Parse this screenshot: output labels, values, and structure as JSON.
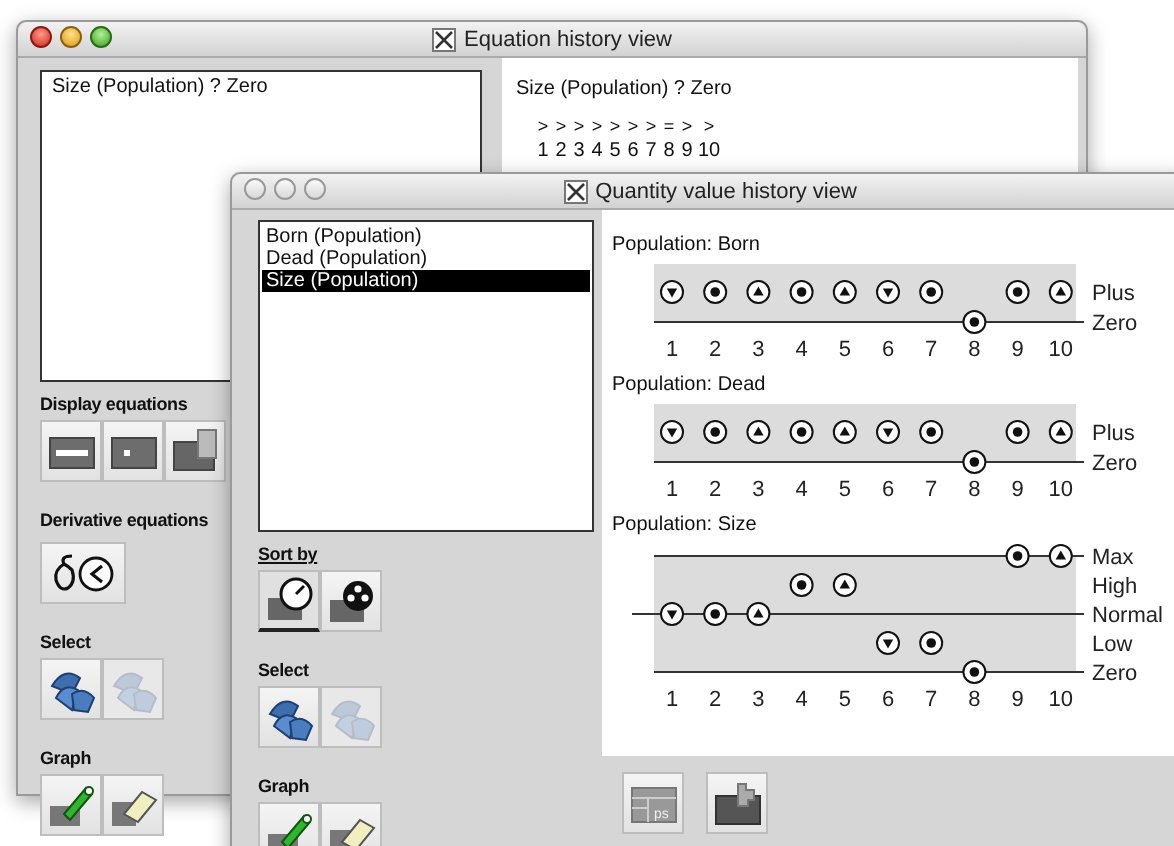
{
  "equation_window": {
    "title": "Equation history view",
    "active": true,
    "list": [
      "Size (Population) ? Zero"
    ],
    "equation": {
      "text": "Size (Population) ? Zero",
      "columns": [
        {
          "symbol": ">",
          "index": "1"
        },
        {
          "symbol": ">",
          "index": "2"
        },
        {
          "symbol": ">",
          "index": "3"
        },
        {
          "symbol": ">",
          "index": "4"
        },
        {
          "symbol": ">",
          "index": "5"
        },
        {
          "symbol": ">",
          "index": "6"
        },
        {
          "symbol": ">",
          "index": "7"
        },
        {
          "symbol": "=",
          "index": "8"
        },
        {
          "symbol": ">",
          "index": "9"
        },
        {
          "symbol": ">",
          "index": "10"
        }
      ]
    },
    "sections": [
      {
        "heading": "Display equations",
        "buttons": [
          {
            "kind": "wide",
            "disabled": false
          },
          {
            "kind": "small",
            "disabled": false
          },
          {
            "kind": "folder-doc",
            "disabled": false
          }
        ]
      },
      {
        "heading": "Derivative equations",
        "buttons": [
          {
            "kind": "delta",
            "disabled": false
          }
        ]
      },
      {
        "heading": "Select",
        "buttons": [
          {
            "kind": "shapes",
            "disabled": false
          },
          {
            "kind": "shapes",
            "disabled": true
          }
        ]
      },
      {
        "heading": "Graph",
        "buttons": [
          {
            "kind": "pencil",
            "disabled": false
          },
          {
            "kind": "eraser",
            "disabled": false
          }
        ]
      }
    ]
  },
  "quantity_window": {
    "title": "Quantity value history view",
    "active": false,
    "list": [
      {
        "label": "Born (Population)",
        "selected": false
      },
      {
        "label": "Dead (Population)",
        "selected": false
      },
      {
        "label": "Size (Population)",
        "selected": true
      }
    ],
    "sort_by": {
      "heading": "Sort by",
      "buttons": [
        {
          "kind": "gauge",
          "selected": true
        },
        {
          "kind": "film",
          "selected": false
        }
      ]
    },
    "sections": [
      {
        "heading": "Select",
        "buttons": [
          {
            "kind": "shapes",
            "disabled": false
          },
          {
            "kind": "shapes",
            "disabled": true
          }
        ]
      },
      {
        "heading": "Graph",
        "buttons": [
          {
            "kind": "pencil",
            "disabled": false
          },
          {
            "kind": "eraser",
            "disabled": false
          }
        ]
      }
    ],
    "graphs": [
      {
        "title": "Population: Born",
        "steps": [
          "1",
          "2",
          "3",
          "4",
          "5",
          "6",
          "7",
          "8",
          "9",
          "10"
        ],
        "rows": [
          {
            "label": "Plus",
            "kind": "interval",
            "marks": [
              {
                "kind": "down"
              },
              {
                "kind": "steady"
              },
              {
                "kind": "up"
              },
              {
                "kind": "steady"
              },
              {
                "kind": "up"
              },
              {
                "kind": "down"
              },
              {
                "kind": "steady"
              },
              {
                "kind": "none"
              },
              {
                "kind": "steady"
              },
              {
                "kind": "up"
              }
            ]
          },
          {
            "label": "Zero",
            "kind": "point",
            "marks": [
              {
                "kind": "none"
              },
              {
                "kind": "none"
              },
              {
                "kind": "none"
              },
              {
                "kind": "none"
              },
              {
                "kind": "none"
              },
              {
                "kind": "none"
              },
              {
                "kind": "none"
              },
              {
                "kind": "steady"
              },
              {
                "kind": "none"
              },
              {
                "kind": "none"
              }
            ]
          }
        ]
      },
      {
        "title": "Population: Dead",
        "steps": [
          "1",
          "2",
          "3",
          "4",
          "5",
          "6",
          "7",
          "8",
          "9",
          "10"
        ],
        "rows": [
          {
            "label": "Plus",
            "kind": "interval",
            "marks": [
              {
                "kind": "down"
              },
              {
                "kind": "steady"
              },
              {
                "kind": "up"
              },
              {
                "kind": "steady"
              },
              {
                "kind": "up"
              },
              {
                "kind": "down"
              },
              {
                "kind": "steady"
              },
              {
                "kind": "none"
              },
              {
                "kind": "steady"
              },
              {
                "kind": "up"
              }
            ]
          },
          {
            "label": "Zero",
            "kind": "point",
            "marks": [
              {
                "kind": "none"
              },
              {
                "kind": "none"
              },
              {
                "kind": "none"
              },
              {
                "kind": "none"
              },
              {
                "kind": "none"
              },
              {
                "kind": "none"
              },
              {
                "kind": "none"
              },
              {
                "kind": "steady"
              },
              {
                "kind": "none"
              },
              {
                "kind": "none"
              }
            ]
          }
        ]
      },
      {
        "title": "Population: Size",
        "steps": [
          "1",
          "2",
          "3",
          "4",
          "5",
          "6",
          "7",
          "8",
          "9",
          "10"
        ],
        "rows": [
          {
            "label": "Max",
            "kind": "point",
            "marks": [
              {
                "kind": "none"
              },
              {
                "kind": "none"
              },
              {
                "kind": "none"
              },
              {
                "kind": "none"
              },
              {
                "kind": "none"
              },
              {
                "kind": "none"
              },
              {
                "kind": "none"
              },
              {
                "kind": "none"
              },
              {
                "kind": "steady"
              },
              {
                "kind": "up"
              }
            ]
          },
          {
            "label": "High",
            "kind": "interval",
            "marks": [
              {
                "kind": "none"
              },
              {
                "kind": "none"
              },
              {
                "kind": "none"
              },
              {
                "kind": "steady"
              },
              {
                "kind": "up"
              },
              {
                "kind": "none"
              },
              {
                "kind": "none"
              },
              {
                "kind": "none"
              },
              {
                "kind": "none"
              },
              {
                "kind": "none"
              }
            ]
          },
          {
            "label": "Normal",
            "kind": "point",
            "marks": [
              {
                "kind": "down"
              },
              {
                "kind": "steady"
              },
              {
                "kind": "up"
              },
              {
                "kind": "none"
              },
              {
                "kind": "none"
              },
              {
                "kind": "none"
              },
              {
                "kind": "none"
              },
              {
                "kind": "none"
              },
              {
                "kind": "none"
              },
              {
                "kind": "none"
              }
            ]
          },
          {
            "label": "Low",
            "kind": "interval",
            "marks": [
              {
                "kind": "none"
              },
              {
                "kind": "none"
              },
              {
                "kind": "none"
              },
              {
                "kind": "none"
              },
              {
                "kind": "none"
              },
              {
                "kind": "down"
              },
              {
                "kind": "steady"
              },
              {
                "kind": "none"
              },
              {
                "kind": "none"
              },
              {
                "kind": "none"
              }
            ]
          },
          {
            "label": "Zero",
            "kind": "point",
            "marks": [
              {
                "kind": "none"
              },
              {
                "kind": "none"
              },
              {
                "kind": "none"
              },
              {
                "kind": "none"
              },
              {
                "kind": "none"
              },
              {
                "kind": "none"
              },
              {
                "kind": "none"
              },
              {
                "kind": "steady"
              },
              {
                "kind": "none"
              },
              {
                "kind": "none"
              }
            ]
          }
        ]
      }
    ],
    "bottom_buttons": [
      {
        "kind": "ps-table",
        "label": "ps"
      },
      {
        "kind": "folder-puzzle"
      }
    ]
  }
}
